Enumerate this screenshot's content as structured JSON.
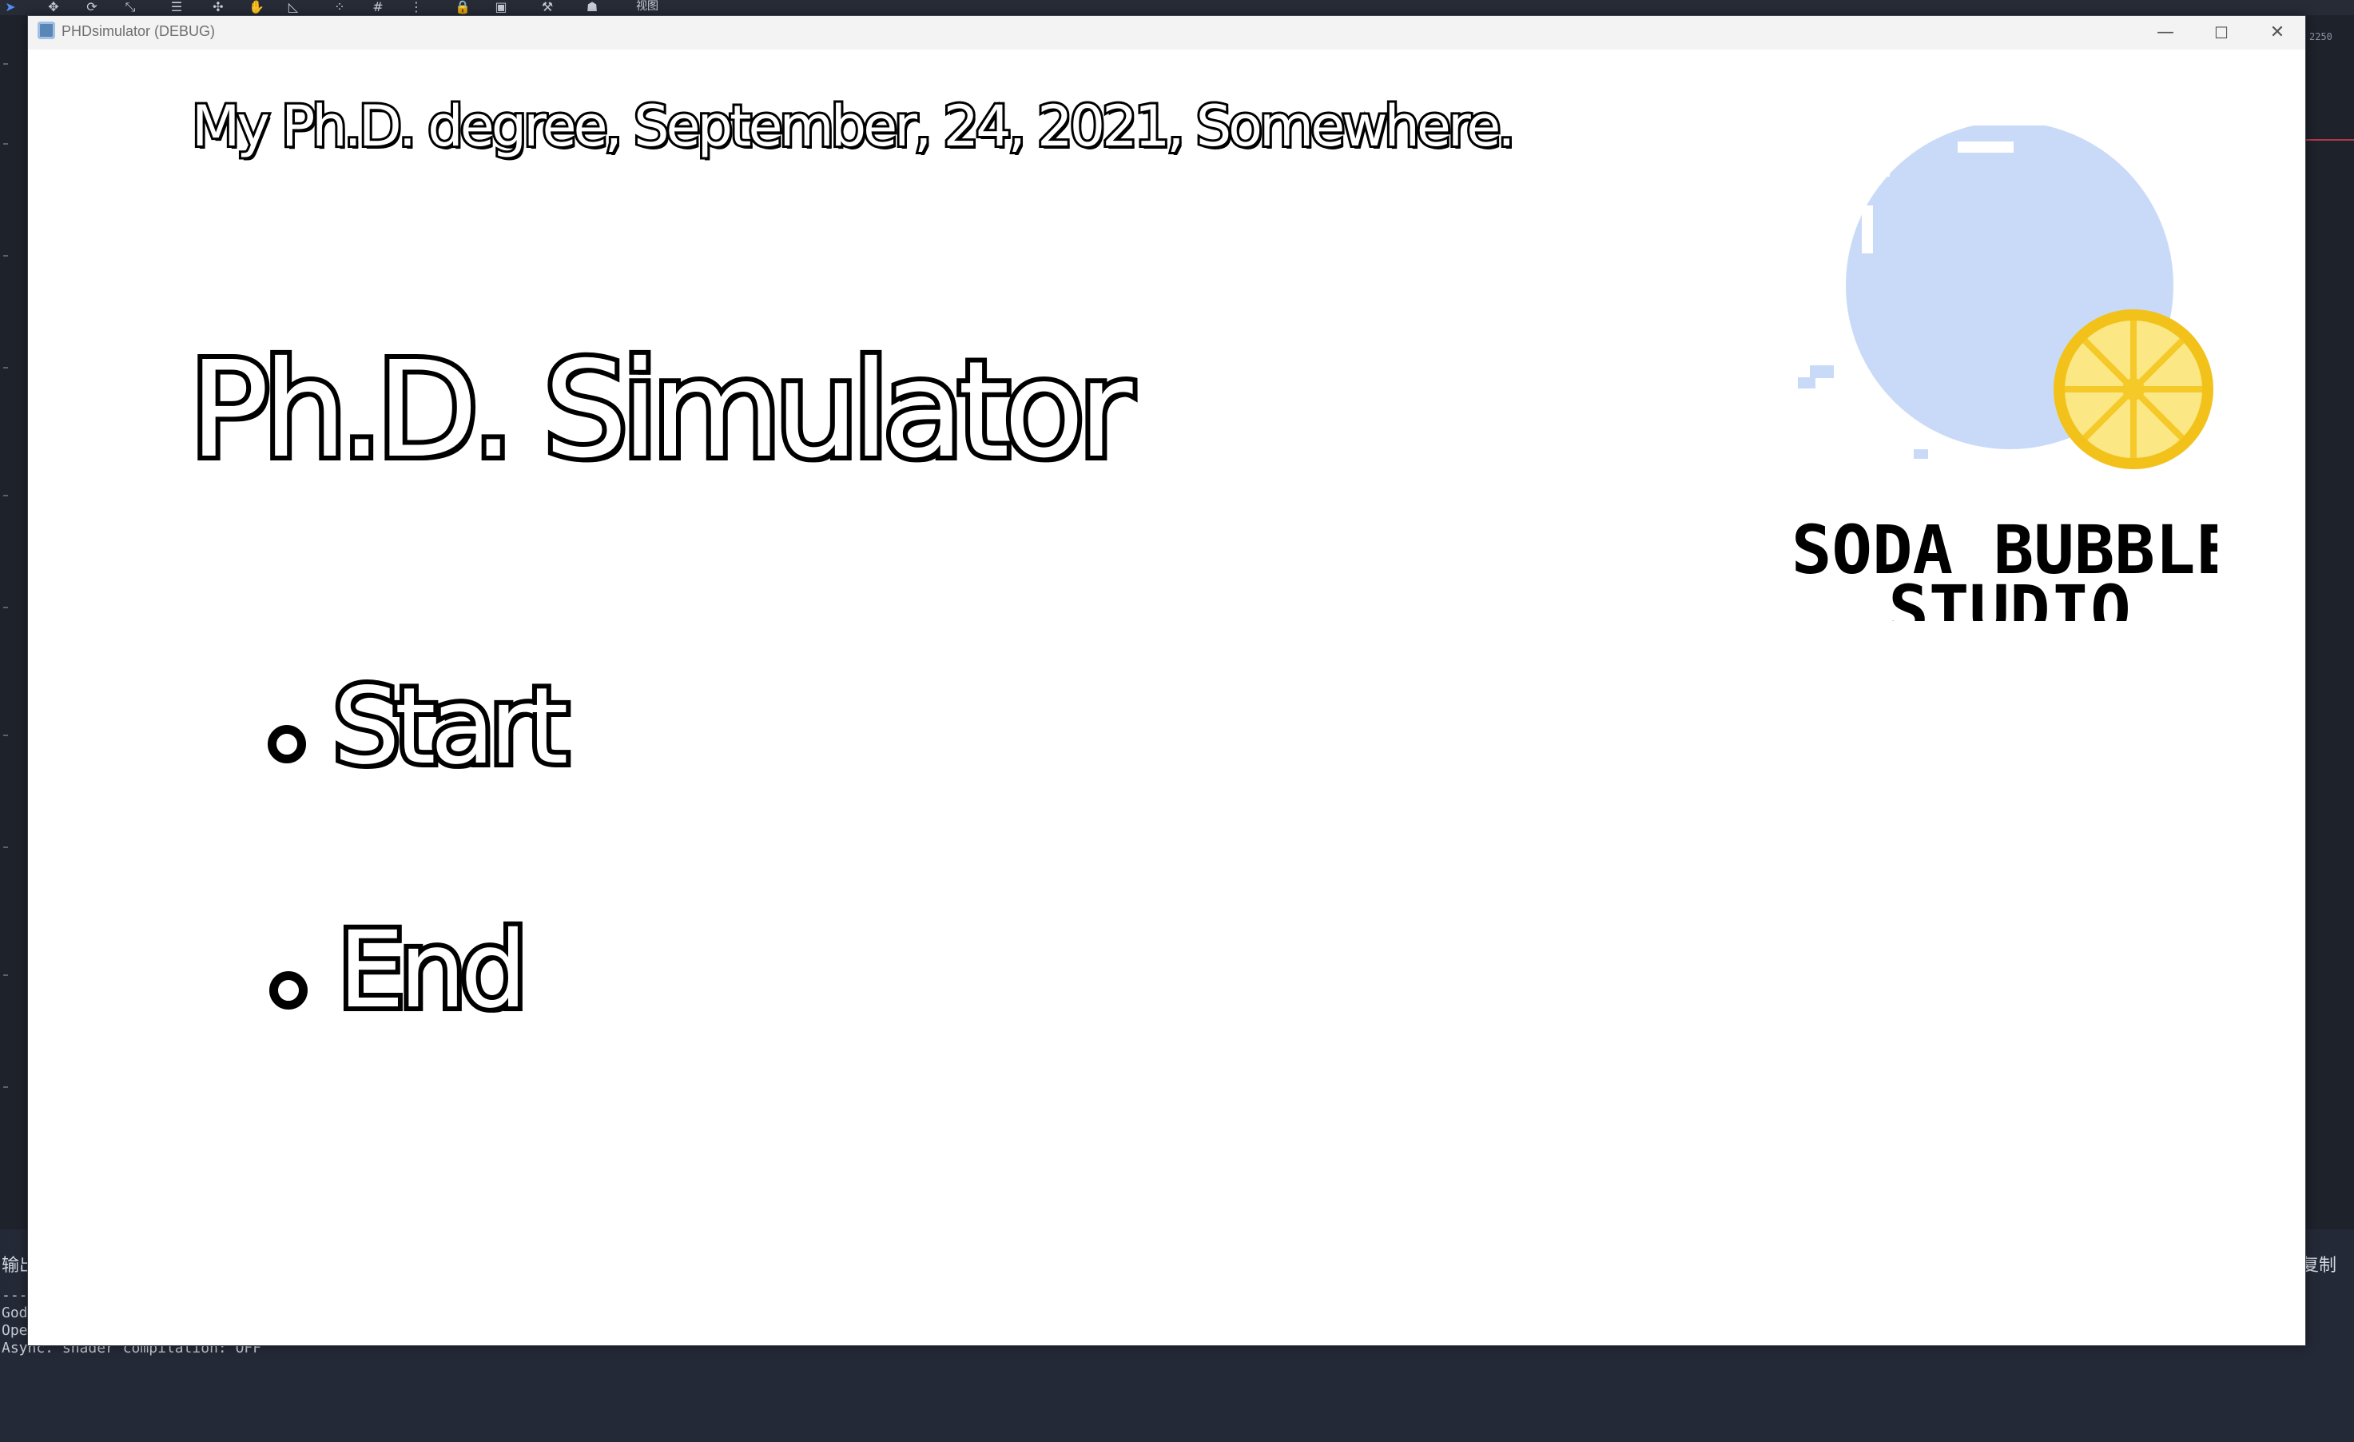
{
  "editor": {
    "toolbar_icons": [
      "select-icon",
      "move-icon",
      "rotate-icon",
      "scale-icon",
      "list-icon",
      "pivot-icon",
      "pan-icon",
      "ruler-icon",
      "snap-icon",
      "grid-icon",
      "more-icon",
      "lock-icon",
      "group-icon",
      "bone-icon",
      "skeleton-icon"
    ],
    "view_menu_label": "视图",
    "ruler_numbers": [
      "2250"
    ],
    "output_tab_left": "输出",
    "output_tab_right": "复制",
    "output_lines": [
      "---",
      "God",
      "Ope",
      "Async. shader compilation: OFF"
    ]
  },
  "window": {
    "title": "PHDsimulator (DEBUG)",
    "minimize_glyph": "—",
    "maximize_glyph": "☐",
    "close_glyph": "✕"
  },
  "game": {
    "subtitle": "My Ph.D. degree, September, 24, 2021, Somewhere.",
    "title": "Ph.D. Simulator",
    "menu": [
      {
        "label": "Start"
      },
      {
        "label": "End"
      }
    ],
    "logo": {
      "line1": "SODA BUBBLE",
      "line2": "STUDIO",
      "bubble_color": "#c9daf8",
      "lemon_color": "#f5d33c"
    }
  }
}
